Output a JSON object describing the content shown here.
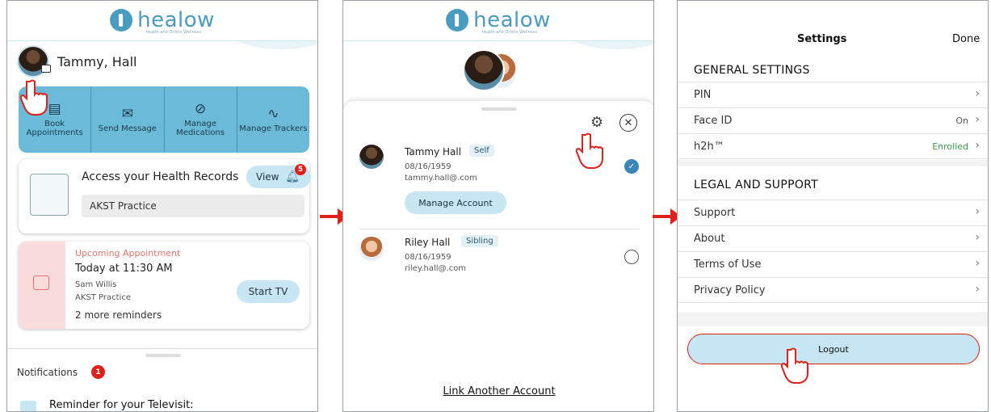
{
  "brand": {
    "name": "healow",
    "tagline": "Health and Online Wellness",
    "accent": "#4a9bc0",
    "highlight": "#e0211b"
  },
  "screen1": {
    "user_name": "Tammy, Hall",
    "quick_actions": [
      {
        "icon": "book-icon",
        "label": "Book Appointments"
      },
      {
        "icon": "envelope-icon",
        "label": "Send Message"
      },
      {
        "icon": "pill-icon",
        "label": "Manage Medications"
      },
      {
        "icon": "heartbeat-icon",
        "label": "Manage Trackers"
      }
    ],
    "health_records": {
      "title": "Access your Health Records",
      "view_label": "View",
      "badge": "5",
      "practice": "AKST Practice"
    },
    "appointment": {
      "label": "Upcoming Appointment",
      "time": "Today at 11:30 AM",
      "doctor": "Sam Willis",
      "practice": "AKST Practice",
      "more": "2 more reminders",
      "action": "Start TV"
    },
    "notifications": {
      "title": "Notifications",
      "count": "1",
      "reminder": "Reminder for your Televisit:"
    }
  },
  "screen2": {
    "accounts": [
      {
        "name": "Tammy Hall",
        "relation": "Self",
        "dob": "08/16/1959",
        "email": "tammy.hall@.com",
        "action": "Manage Account",
        "selected": true
      },
      {
        "name": "Riley Hall",
        "relation": "Sibling",
        "dob": "08/16/1959",
        "email": "riley.hall@.com",
        "selected": false
      }
    ],
    "link_account": "Link Another Account"
  },
  "screen3": {
    "title": "Settings",
    "done": "Done",
    "general": {
      "heading": "GENERAL SETTINGS",
      "items": [
        {
          "label": "PIN",
          "value": ""
        },
        {
          "label": "Face ID",
          "value": "On"
        },
        {
          "label": "h2h™",
          "value": "Enrolled"
        }
      ]
    },
    "legal": {
      "heading": "LEGAL AND SUPPORT",
      "items": [
        {
          "label": "Support"
        },
        {
          "label": "About"
        },
        {
          "label": "Terms of Use"
        },
        {
          "label": "Privacy Policy"
        }
      ]
    },
    "logout": "Logout"
  }
}
